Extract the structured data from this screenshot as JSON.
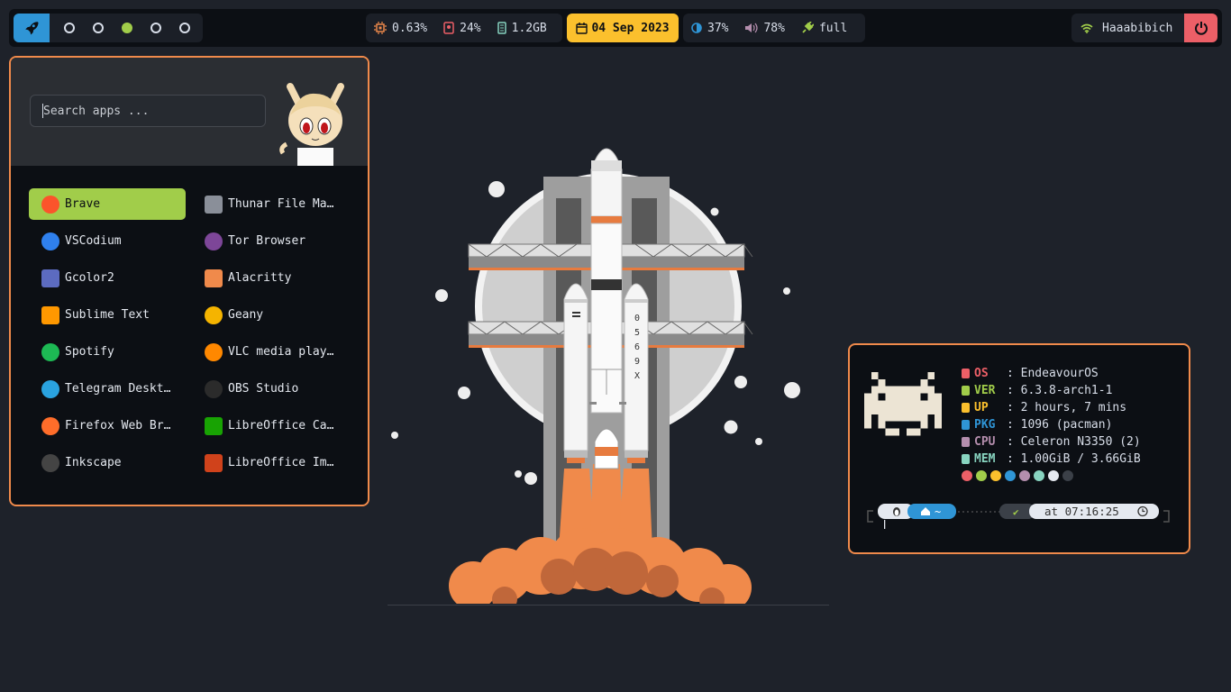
{
  "topbar": {
    "workspaces": [
      false,
      false,
      true,
      false,
      false
    ],
    "cpu": "0.63%",
    "disk": "24%",
    "ram": "1.2GB",
    "date": "04 Sep 2023",
    "brightness": "37%",
    "volume": "78%",
    "battery": "full",
    "wifi": "Haaabibich"
  },
  "launcher": {
    "search_placeholder": "Search apps ...",
    "apps": [
      {
        "label": "Brave",
        "icon": "brave-icon",
        "selected": true
      },
      {
        "label": "Thunar File Ma…",
        "icon": "thunar-icon"
      },
      {
        "label": "VSCodium",
        "icon": "vscodium-icon"
      },
      {
        "label": "Tor Browser",
        "icon": "tor-icon"
      },
      {
        "label": "Gcolor2",
        "icon": "gcolor-icon"
      },
      {
        "label": "Alacritty",
        "icon": "alacritty-icon"
      },
      {
        "label": "Sublime Text",
        "icon": "sublime-icon"
      },
      {
        "label": "Geany",
        "icon": "geany-icon"
      },
      {
        "label": "Spotify",
        "icon": "spotify-icon"
      },
      {
        "label": "VLC media play…",
        "icon": "vlc-icon"
      },
      {
        "label": "Telegram Deskt…",
        "icon": "telegram-icon"
      },
      {
        "label": "OBS Studio",
        "icon": "obs-icon"
      },
      {
        "label": "Firefox Web Br…",
        "icon": "firefox-icon"
      },
      {
        "label": "LibreOffice Ca…",
        "icon": "libreoffice-calc-icon"
      },
      {
        "label": "Inkscape",
        "icon": "inkscape-icon"
      },
      {
        "label": "LibreOffice Im…",
        "icon": "libreoffice-impress-icon"
      }
    ]
  },
  "rocket": {
    "label_chars": [
      "0",
      "5",
      "6",
      "9",
      "X"
    ]
  },
  "fetch": {
    "rows": [
      {
        "key": "OS",
        "value": "EndeavourOS",
        "color": "#ec5f67"
      },
      {
        "key": "VER",
        "value": "6.3.8-arch1-1",
        "color": "#a1cd4a"
      },
      {
        "key": "UP",
        "value": "2 hours, 7 mins",
        "color": "#fbc02d"
      },
      {
        "key": "PKG",
        "value": "1096 (pacman)",
        "color": "#2f95d6"
      },
      {
        "key": "CPU",
        "value": "Celeron N3350 (2)",
        "color": "#b48ead"
      },
      {
        "key": "MEM",
        "value": "1.00GiB / 3.66GiB",
        "color": "#88d4c0"
      }
    ],
    "palette": [
      "#ec5f67",
      "#a1cd4a",
      "#fbc02d",
      "#2f95d6",
      "#b48ead",
      "#88d4c0",
      "#e5e9f0",
      "#3b4048"
    ],
    "prompt_dir": "~",
    "prompt_time": "at 07:16:25",
    "prompt_check": "✔"
  }
}
